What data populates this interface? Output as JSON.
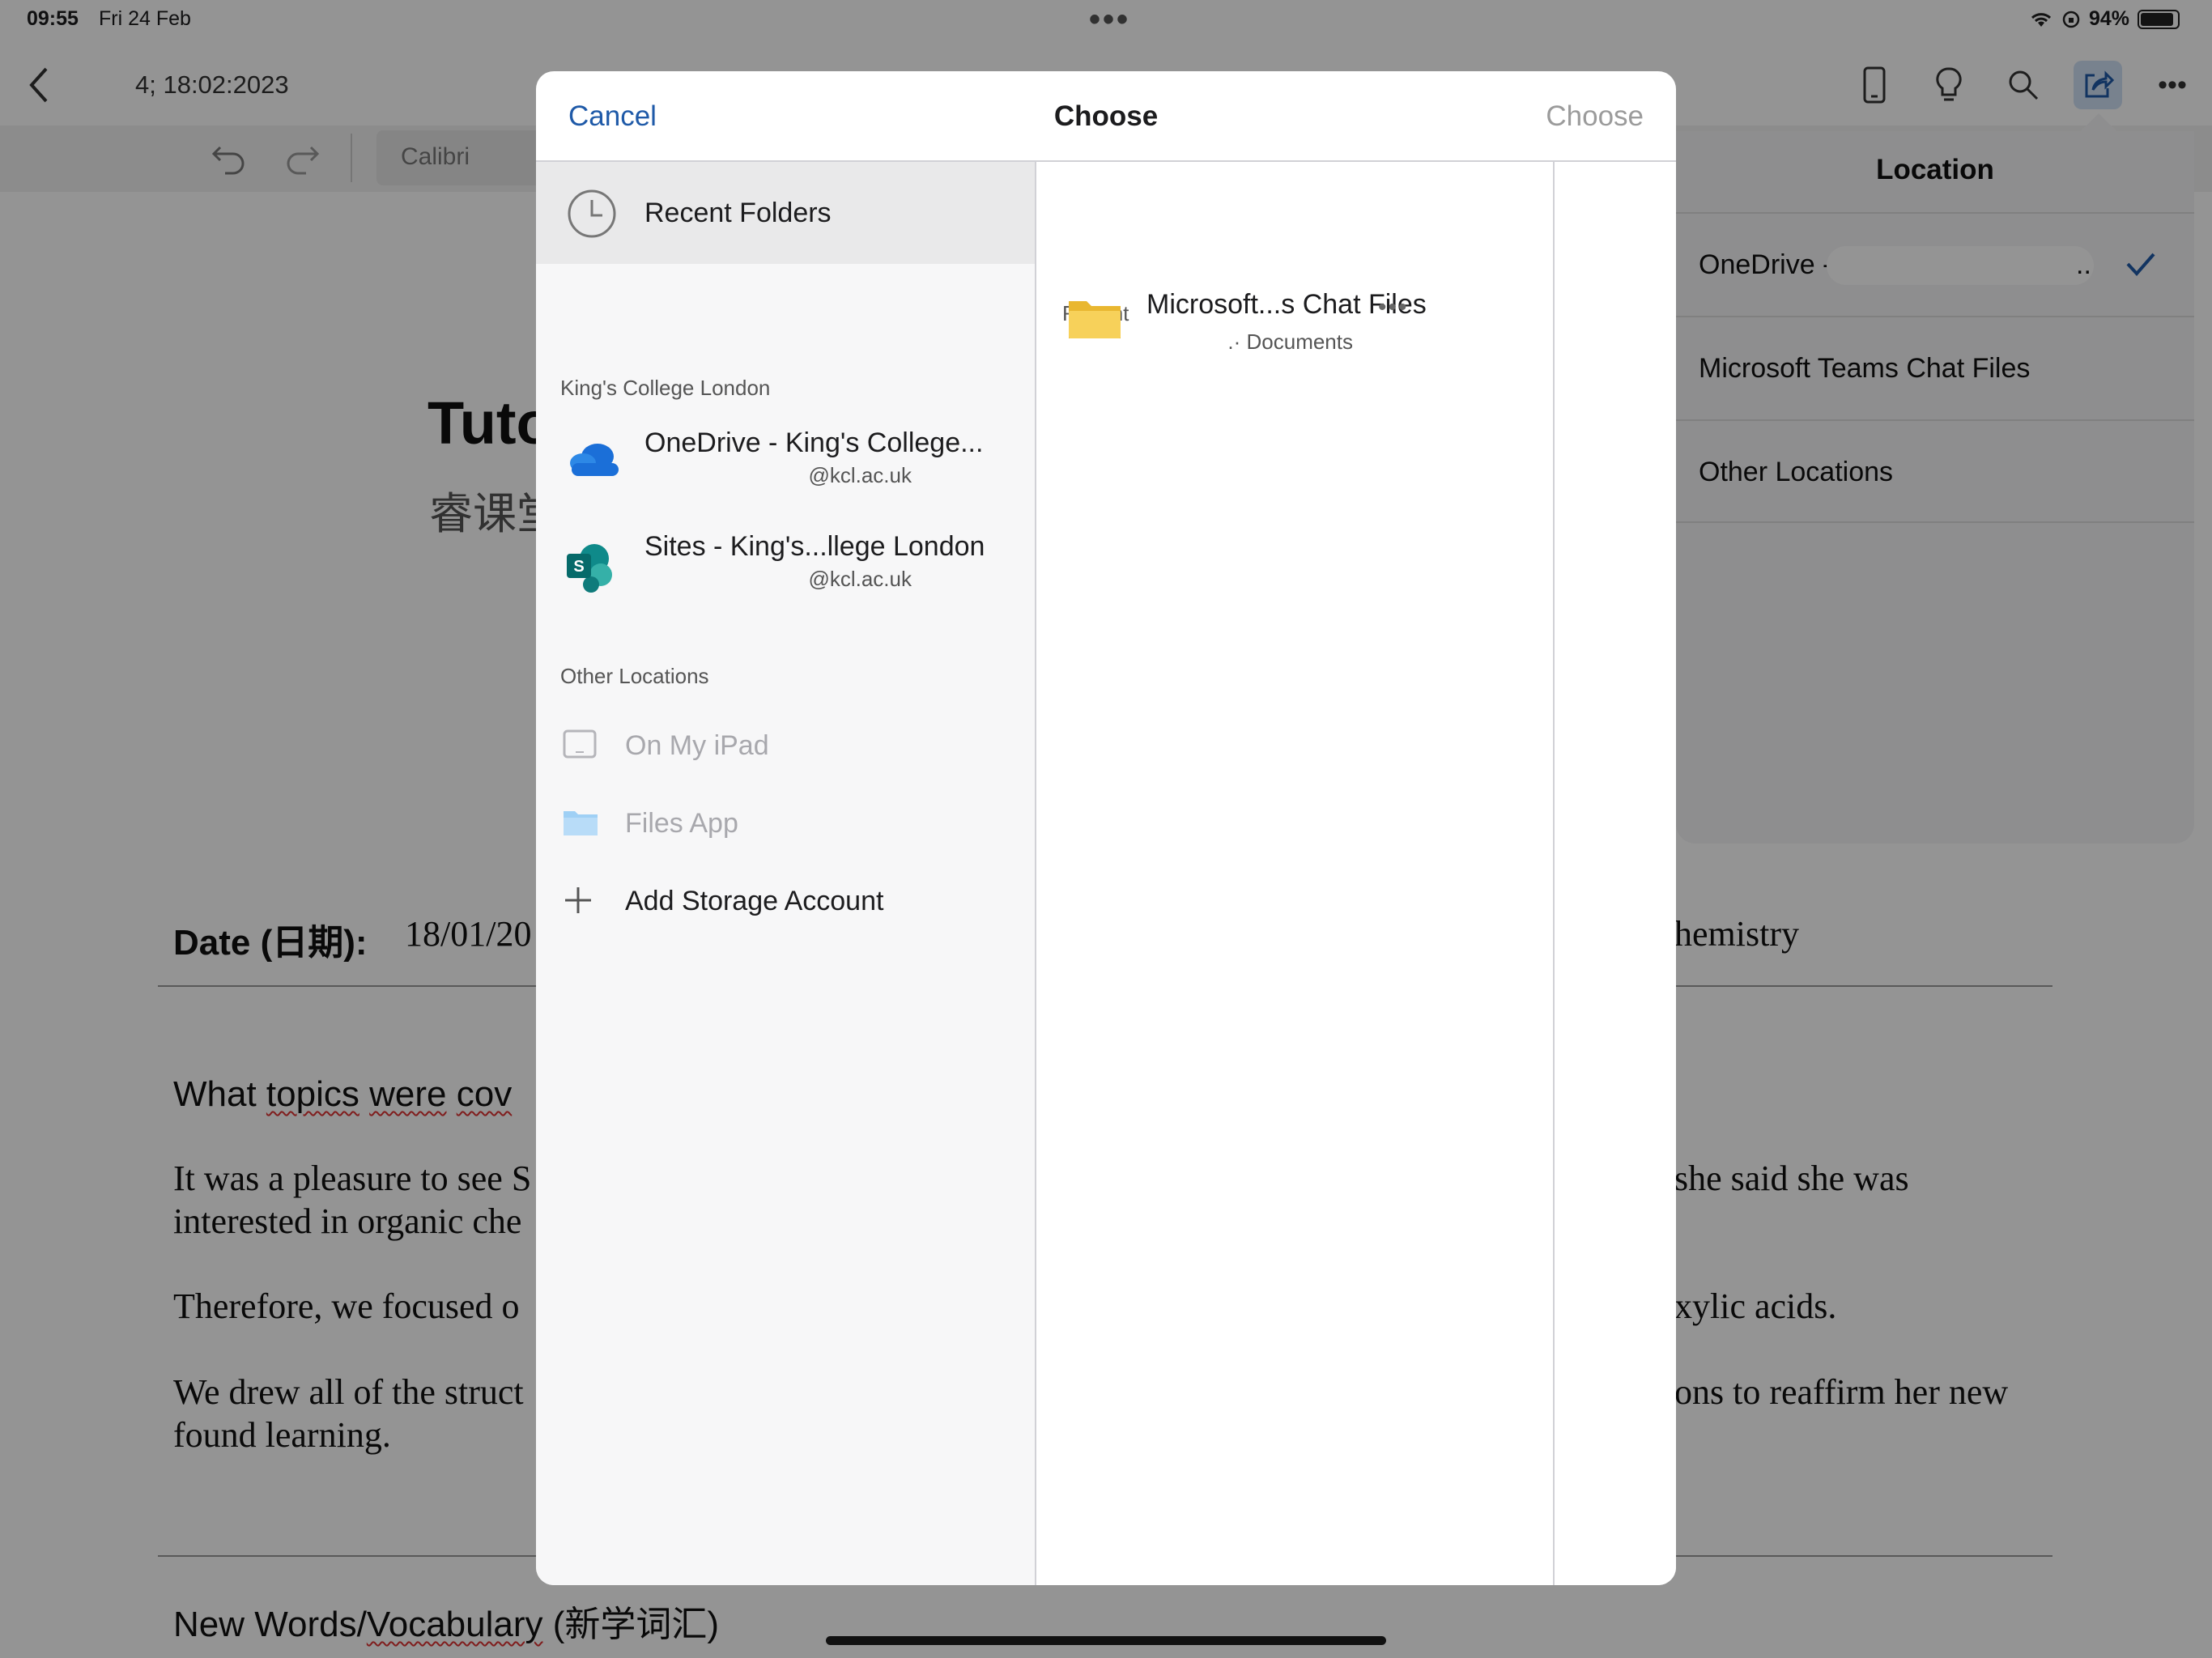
{
  "status_bar": {
    "time": "09:55",
    "date": "Fri 24 Feb",
    "battery": "94%"
  },
  "document": {
    "title_suffix": "4; 18:02:2023",
    "font_name": "Calibri",
    "heading_fragment": "Tuto",
    "subheading_fragment": "睿课堂",
    "date_label": "Date (日期):",
    "date_value_fragment": "18/01/20",
    "subject_fragment": "hemistry",
    "topics_heading": {
      "a": "What ",
      "b": "topics",
      "c": " ",
      "d": "were",
      "e": " ",
      "f": "cov"
    },
    "para1_line1_left": "It was a pleasure to see S",
    "para1_line1_right": "she said she was",
    "para1_line2_left": "interested in organic che",
    "para2_left": "Therefore, we focused o",
    "para2_right": "xylic acids.",
    "para3_line1_left": "We drew all of the struct",
    "para3_line1_right": "ons to reaffirm her new",
    "para3_line2_left": "found learning.",
    "vocab_heading": {
      "a": "New Words/",
      "b": "Vocabulary",
      "c": " (新学词汇)"
    }
  },
  "location_panel": {
    "title": "Location",
    "items": [
      {
        "label": "OneDrive -",
        "suffix": "..",
        "selected": true
      },
      {
        "label": "Microsoft Teams Chat Files"
      },
      {
        "label": "Other Locations"
      }
    ]
  },
  "modal": {
    "cancel_label": "Cancel",
    "title": "Choose",
    "choose_label": "Choose",
    "recent_folders_label": "Recent Folders",
    "kcl_section_header": "King's College London",
    "accounts": [
      {
        "name": "OneDrive - King's College...",
        "email": "@kcl.ac.uk",
        "icon": "onedrive-icon"
      },
      {
        "name": "Sites - King's...llege London",
        "email": "@kcl.ac.uk",
        "icon": "sharepoint-icon"
      }
    ],
    "other_section_header": "Other Locations",
    "other_locations": [
      {
        "label": "On My iPad",
        "icon": "ipad-icon",
        "disabled": true
      },
      {
        "label": "Files App",
        "icon": "folder-icon",
        "disabled": true
      },
      {
        "label": "Add Storage Account",
        "icon": "plus-icon",
        "disabled": false
      }
    ],
    "recent_header": "Recent",
    "recent_files": [
      {
        "name": "Microsoft...s Chat Files",
        "subtitle": ".· Documents",
        "icon": "folder-icon",
        "more": "•••"
      }
    ]
  },
  "colors": {
    "accent": "#1f5aa8",
    "folder": "#f5c74a",
    "onedrive": "#1b6fd8",
    "sharepoint": "#0f7b7b"
  }
}
